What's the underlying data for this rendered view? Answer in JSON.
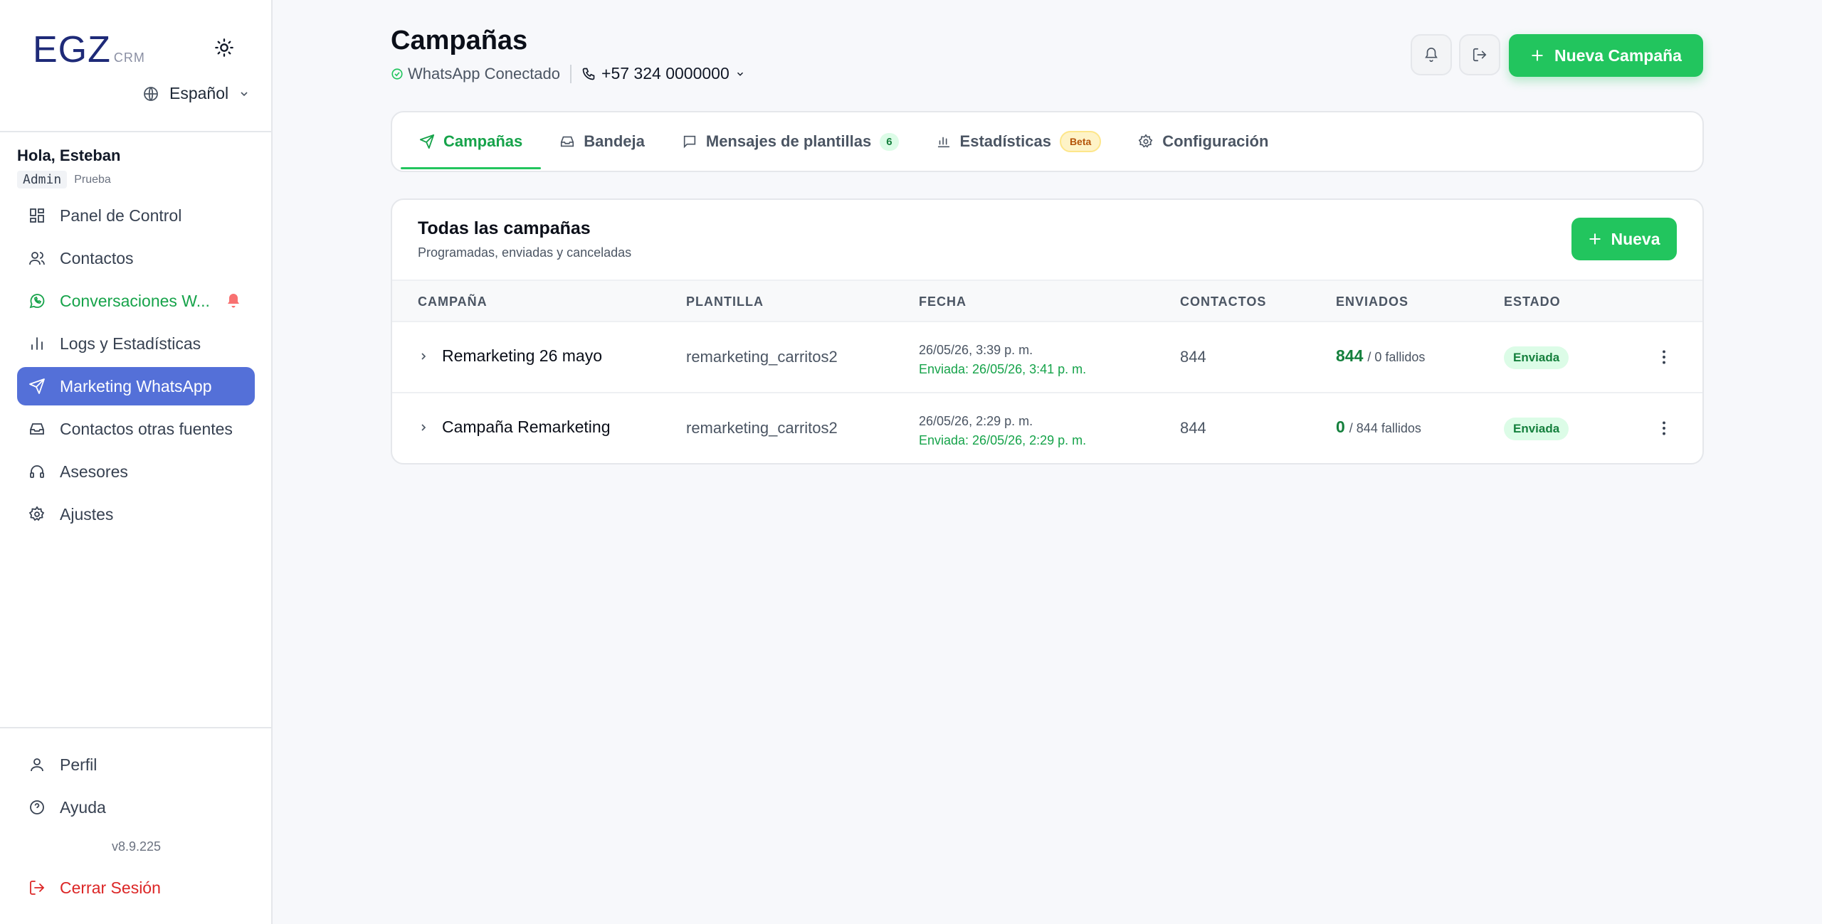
{
  "brand": {
    "logo_main": "EGZ",
    "logo_sub": "CRM"
  },
  "language": {
    "selected": "Español"
  },
  "user": {
    "greeting": "Hola, Esteban",
    "role": "Admin",
    "org": "Prueba"
  },
  "sidebar": {
    "items": [
      {
        "label": "Panel de Control",
        "icon": "dashboard-icon"
      },
      {
        "label": "Contactos",
        "icon": "users-icon"
      },
      {
        "label": "Conversaciones W...",
        "icon": "whatsapp-icon"
      },
      {
        "label": "Logs y Estadísticas",
        "icon": "bar-chart-icon"
      },
      {
        "label": "Marketing WhatsApp",
        "icon": "send-icon"
      },
      {
        "label": "Contactos otras fuentes",
        "icon": "inbox-icon"
      },
      {
        "label": "Asesores",
        "icon": "headset-icon"
      },
      {
        "label": "Ajustes",
        "icon": "gear-icon"
      }
    ],
    "bottom": [
      {
        "label": "Perfil",
        "icon": "user-icon"
      },
      {
        "label": "Ayuda",
        "icon": "help-icon"
      }
    ],
    "version": "v8.9.225",
    "logout": "Cerrar Sesión"
  },
  "header": {
    "title": "Campañas",
    "status": "WhatsApp Conectado",
    "phone": "+57 324 0000000",
    "new_campaign": "Nueva Campaña"
  },
  "tabs": [
    {
      "label": "Campañas"
    },
    {
      "label": "Bandeja"
    },
    {
      "label": "Mensajes de plantillas",
      "badge": "6"
    },
    {
      "label": "Estadísticas",
      "badge": "Beta"
    },
    {
      "label": "Configuración"
    }
  ],
  "panel": {
    "title": "Todas las campañas",
    "subtitle": "Programadas, enviadas y canceladas",
    "new_button": "Nueva",
    "columns": [
      "CAMPAÑA",
      "PLANTILLA",
      "FECHA",
      "CONTACTOS",
      "ENVIADOS",
      "ESTADO"
    ],
    "rows": [
      {
        "name": "Remarketing 26 mayo",
        "template": "remarketing_carritos2",
        "scheduled": "26/05/26, 3:39 p. m.",
        "sent_at": "Enviada: 26/05/26, 3:41 p. m.",
        "contacts": "844",
        "sent": "844",
        "failed": "/ 0 fallidos",
        "status": "Enviada"
      },
      {
        "name": "Campaña Remarketing",
        "template": "remarketing_carritos2",
        "scheduled": "26/05/26, 2:29 p. m.",
        "sent_at": "Enviada: 26/05/26, 2:29 p. m.",
        "contacts": "844",
        "sent": "0",
        "failed": "/ 844 fallidos",
        "status": "Enviada"
      }
    ]
  },
  "colors": {
    "accent_green": "#22c55e",
    "active_nav": "#5470d8",
    "danger": "#dc2626"
  }
}
